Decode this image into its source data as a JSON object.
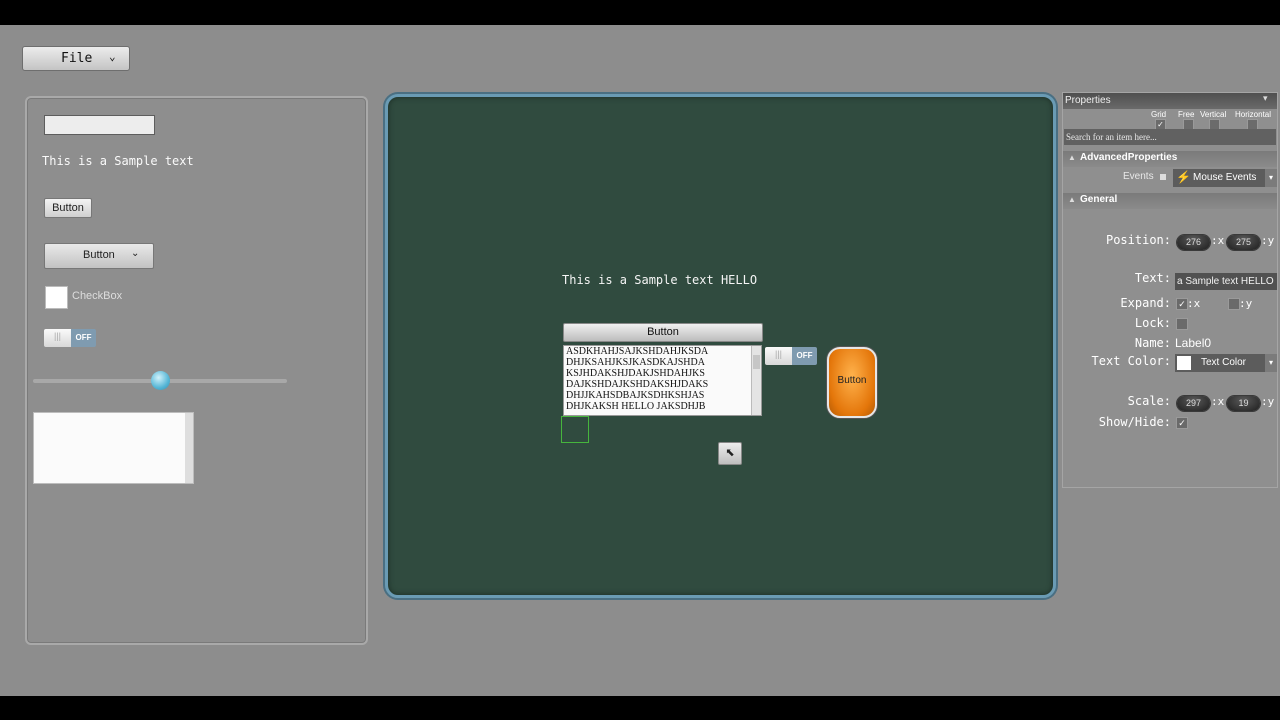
{
  "menu": {
    "file_label": "File",
    "file_chevron": "⌄"
  },
  "toolbox": {
    "sample_text": "This is a Sample text",
    "button_label": "Button",
    "dropdown_label": "Button",
    "dropdown_chevron": "⌄",
    "checkbox_label": "CheckBox",
    "toggle_knob": "|||",
    "toggle_off": "OFF",
    "slider_value": 0.5
  },
  "canvas": {
    "sample_text": "This is a Sample text HELLO",
    "button_label": "Button",
    "list_lines": [
      "ASDKHAHJSAJKSHDAHJKSDA",
      "DHJKSAHJKSJKASDKAJSHDA",
      "KSJHDAKSHJDAKJSHDAHJKS",
      "DAJKSHDAJKSHDAKSHJDAKS",
      "DHJJKAHSDBAJKSDHKSHJAS",
      "DHJKAKSH HELLO JAKSDHJB"
    ],
    "toggle_knob": "|||",
    "toggle_off": "OFF",
    "orange_button_label": "Button",
    "cursor_glyph": "⬉"
  },
  "properties": {
    "tab_label": "Properties",
    "pin_glyph": "▾",
    "modes": [
      {
        "label": "Grid",
        "checked": "✓"
      },
      {
        "label": "Free",
        "checked": ""
      },
      {
        "label": "Vertical",
        "checked": ""
      },
      {
        "label": "Horizontal",
        "checked": ""
      }
    ],
    "search_placeholder": "Search for an item here...",
    "advanced_title": "AdvancedProperties",
    "events_label": "Events",
    "events_value": "Mouse Events",
    "events_icon": "⚡",
    "general_title": "General",
    "position_label": "Position:",
    "position_x": "276",
    "position_y": "275",
    "x_suffix": ":x",
    "y_suffix": ":y",
    "text_label": "Text:",
    "text_value": "a Sample text HELLO",
    "expand_label": "Expand:",
    "expand_x_check": "✓",
    "expand_y_check": "",
    "lock_label": "Lock:",
    "lock_check": "",
    "name_label": "Name:",
    "name_value": "Label0",
    "text_color_label": "Text Color:",
    "text_color_value": "Text Color",
    "text_color_hex": "#ffffff",
    "scale_label": "Scale:",
    "scale_x": "297",
    "scale_y": "19",
    "show_hide_label": "Show/Hide:",
    "show_hide_check": "✓"
  },
  "colors": {
    "canvas_bg": "#304b3f",
    "canvas_border": "#6a9bb4",
    "app_bg": "#8d8d8d",
    "slider_accent": "#56b6d6",
    "orange_button": "#e4760a",
    "selection_outline": "#46b53d"
  }
}
